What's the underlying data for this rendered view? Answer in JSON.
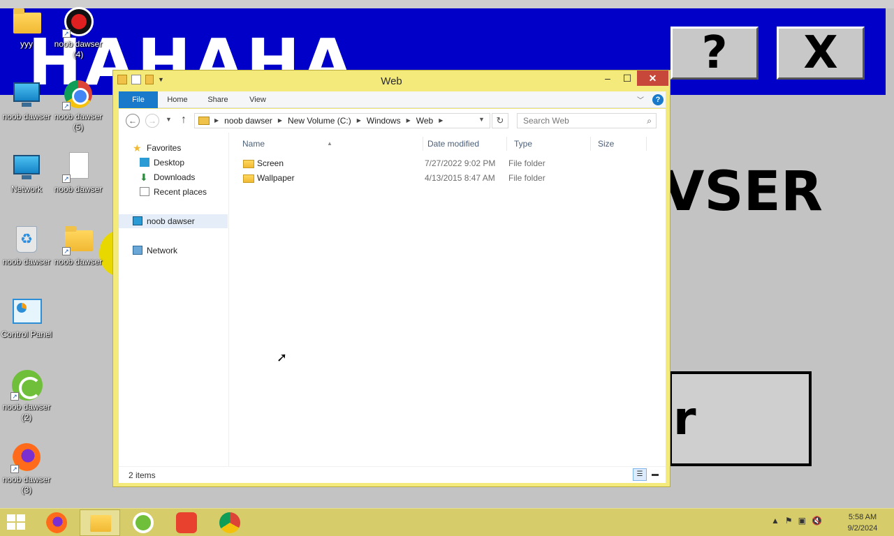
{
  "background_window": {
    "banner_text": "HAHAHA",
    "help_button": "?",
    "close_button": "X",
    "body_text": "VSER",
    "dialog_button_text": "r"
  },
  "desktop_icons": [
    {
      "label": "yyy",
      "icon": "folder-icon"
    },
    {
      "label": "noob dawser (4)",
      "icon": "shortcut-app-icon"
    },
    {
      "label": "noob dawser",
      "icon": "computer-icon"
    },
    {
      "label": "noob dawser (5)",
      "icon": "chrome-icon"
    },
    {
      "label": "Network",
      "icon": "network-icon"
    },
    {
      "label": "noob dawser",
      "icon": "document-icon"
    },
    {
      "label": "noob dawser",
      "icon": "recycle-bin-icon"
    },
    {
      "label": "noob dawser",
      "icon": "folder-shortcut-icon"
    },
    {
      "label": "Control Panel",
      "icon": "control-panel-icon"
    },
    {
      "label": "noob dawser (2)",
      "icon": "app-icon"
    },
    {
      "label": "noob dawser (3)",
      "icon": "firefox-icon"
    }
  ],
  "explorer": {
    "title": "Web",
    "window_buttons": {
      "minimize": "–",
      "maximize": "☐",
      "close": "✕"
    },
    "ribbon_tabs": [
      "File",
      "Home",
      "Share",
      "View"
    ],
    "ribbon_help": "?",
    "address": {
      "crumbs": [
        "noob dawser",
        "New Volume (C:)",
        "Windows",
        "Web"
      ]
    },
    "search_placeholder": "Search Web",
    "nav_pane": {
      "favorites": "Favorites",
      "desktop": "Desktop",
      "downloads": "Downloads",
      "recent": "Recent places",
      "this_pc": "noob dawser",
      "network": "Network"
    },
    "columns": {
      "name": "Name",
      "date": "Date modified",
      "type": "Type",
      "size": "Size"
    },
    "files": [
      {
        "name": "Screen",
        "date": "7/27/2022 9:02 PM",
        "type": "File folder"
      },
      {
        "name": "Wallpaper",
        "date": "4/13/2015 8:47 AM",
        "type": "File folder"
      }
    ],
    "status": "2 items"
  },
  "taskbar": {
    "apps": [
      "firefox-icon",
      "file-explorer-icon",
      "green-app-icon",
      "red-app-icon",
      "chrome-icon"
    ],
    "clock_time": "5:58 AM",
    "clock_date": "9/2/2024"
  },
  "colors": {
    "window_frame": "#f3ea7b",
    "banner": "#0000c8",
    "file_tab": "#1979ca",
    "close_button": "#c7483b",
    "taskbar": "#d6cd6a"
  }
}
